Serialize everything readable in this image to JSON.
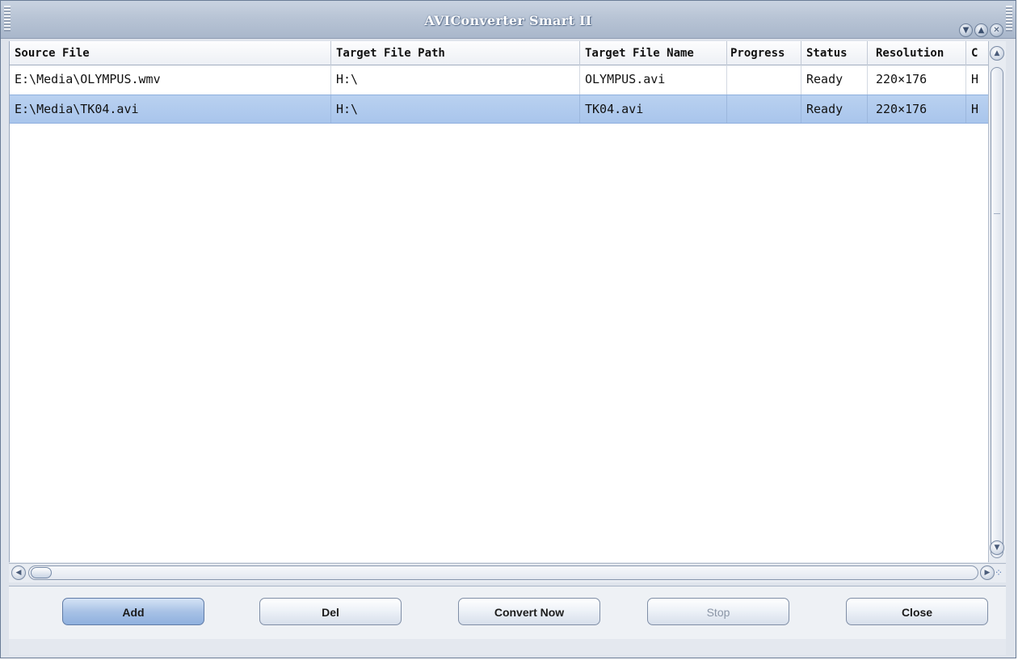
{
  "window": {
    "title": "AVIConverter Smart II"
  },
  "table": {
    "columns": [
      "Source File",
      "Target File Path",
      "Target File Name",
      "Progress",
      "Status",
      "Resolution",
      "C"
    ],
    "rows": [
      [
        "E:\\Media\\OLYMPUS.wmv",
        "H:\\",
        "OLYMPUS.avi",
        "",
        "Ready",
        "220×176",
        "H"
      ],
      [
        "E:\\Media\\TK04.avi",
        "H:\\",
        "TK04.avi",
        "",
        "Ready",
        "220×176",
        "H"
      ]
    ],
    "selected_row": 1
  },
  "buttons": {
    "add": "Add",
    "del": "Del",
    "convert": "Convert Now",
    "stop": "Stop",
    "close": "Close"
  },
  "icons": {
    "minimize": "minimize-icon",
    "maximize": "maximize-icon",
    "close": "close-icon",
    "scroll_up": "chevron-up-icon",
    "scroll_down": "chevron-down-icon",
    "scroll_left": "chevron-left-icon",
    "scroll_right": "chevron-right-icon"
  },
  "colors": {
    "selection": "#b0cbee",
    "title_bar": "#b8c4d5",
    "primary_button": "#a8c2e6"
  }
}
